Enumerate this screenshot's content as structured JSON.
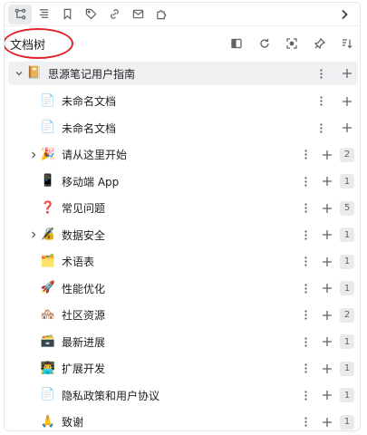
{
  "dock_tabs": [
    {
      "icon": "outline-icon"
    },
    {
      "icon": "file-tree-icon"
    },
    {
      "icon": "bookmark-icon"
    },
    {
      "icon": "tag-icon"
    },
    {
      "icon": "link-icon"
    },
    {
      "icon": "mail-icon"
    },
    {
      "icon": "puzzle-icon"
    }
  ],
  "header": {
    "title": "文档树",
    "tools": [
      "collapse-panel-icon",
      "refresh-icon",
      "focus-icon",
      "pin-icon",
      "sort-icon"
    ]
  },
  "notebook": {
    "icon": "📔",
    "label": "思源笔记用户指南"
  },
  "docs": [
    {
      "label": "未命名文档",
      "icon": "📄",
      "has_children": false,
      "count": ""
    },
    {
      "label": "未命名文档",
      "icon": "📄",
      "has_children": false,
      "count": ""
    },
    {
      "label": "请从这里开始",
      "icon": "🎉",
      "has_children": true,
      "count": "2"
    },
    {
      "label": "移动端 App",
      "icon": "📱",
      "has_children": false,
      "count": "1"
    },
    {
      "label": "常见问题",
      "icon": "❓",
      "has_children": false,
      "count": "5"
    },
    {
      "label": "数据安全",
      "icon": "🔏",
      "has_children": true,
      "count": "1"
    },
    {
      "label": "术语表",
      "icon": "🗂️",
      "has_children": false,
      "count": "1"
    },
    {
      "label": "性能优化",
      "icon": "🚀",
      "has_children": false,
      "count": "1"
    },
    {
      "label": "社区资源",
      "icon": "🏘️",
      "has_children": false,
      "count": "2"
    },
    {
      "label": "最新进展",
      "icon": "🗃️",
      "has_children": false,
      "count": "1"
    },
    {
      "label": "扩展开发",
      "icon": "👨‍💻",
      "has_children": false,
      "count": "1"
    },
    {
      "label": "隐私政策和用户协议",
      "icon": "📄",
      "has_children": false,
      "count": "1"
    },
    {
      "label": "致谢",
      "icon": "🙏",
      "has_children": false,
      "count": "1"
    }
  ],
  "colors": {
    "selected_row": "#eef0f2",
    "highlight_oval": "#e0232b",
    "count_badge": "#e8eaed"
  }
}
